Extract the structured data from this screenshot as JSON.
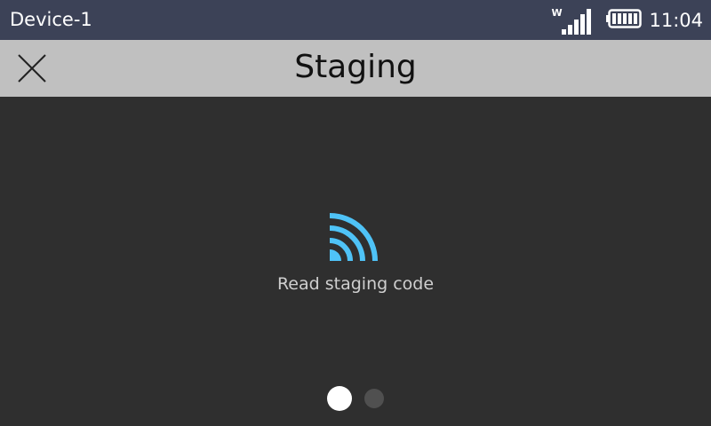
{
  "status_bar": {
    "device_name": "Device-1",
    "network_label": "W",
    "signal_icon": "signal-bars-icon",
    "battery_icon": "battery-full-icon",
    "time": "11:04"
  },
  "header": {
    "title": "Staging",
    "close_icon": "close-icon"
  },
  "main": {
    "icon": "nfc-waves-icon",
    "icon_color": "#4fc3f7",
    "message": "Read staging code"
  },
  "pager": {
    "pages": 2,
    "active_index": 0
  },
  "colors": {
    "status_bar_bg": "#3c4257",
    "title_bar_bg": "#c0c0c0",
    "background": "#2f2f2f"
  }
}
